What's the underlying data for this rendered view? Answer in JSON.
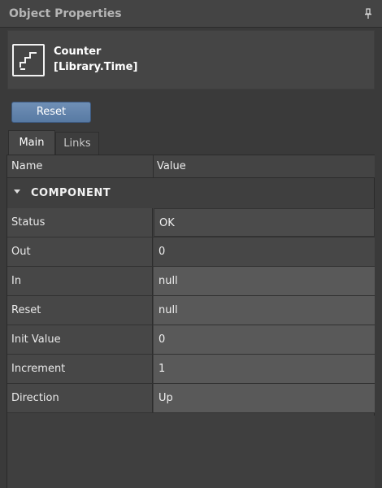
{
  "panel": {
    "title": "Object Properties",
    "pin_icon": "pin-icon"
  },
  "component": {
    "icon": "step-counter-icon",
    "name_line1": "Counter",
    "name_line2": "[Library.Time]"
  },
  "actions": {
    "reset_label": "Reset"
  },
  "tabs": [
    {
      "label": "Main",
      "active": true
    },
    {
      "label": "Links",
      "active": false
    }
  ],
  "grid": {
    "columns": [
      "Name",
      "Value"
    ],
    "section": "COMPONENT",
    "rows": [
      {
        "name": "Status",
        "value": "OK"
      },
      {
        "name": "Out",
        "value": "0"
      },
      {
        "name": "In",
        "value": "null"
      },
      {
        "name": "Reset",
        "value": "null"
      },
      {
        "name": "Init Value",
        "value": "0"
      },
      {
        "name": "Increment",
        "value": "1"
      },
      {
        "name": "Direction",
        "value": "Up"
      }
    ]
  },
  "colors": {
    "button_accent": "#6384ad",
    "panel_bg": "#3a3a3a"
  }
}
